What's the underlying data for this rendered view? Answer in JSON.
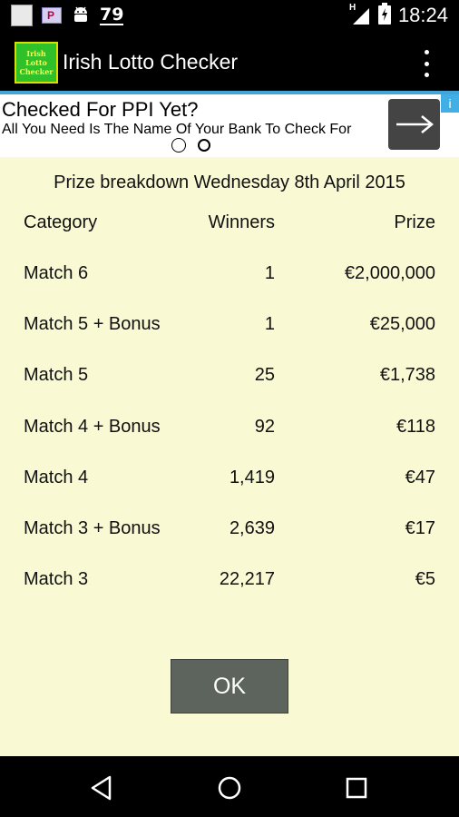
{
  "status_bar": {
    "notif_badge": "P",
    "battery_level": "79",
    "network_type": "H",
    "time": "18:24",
    "icons": [
      "notification-square-icon",
      "parking-badge-icon",
      "android-icon",
      "signal-icon",
      "battery-icon"
    ]
  },
  "action_bar": {
    "logo_lines": [
      "Irish",
      "Lotto",
      "Checker"
    ],
    "title": "Irish Lotto Checker",
    "menu_icon": "overflow-menu-icon"
  },
  "ad": {
    "title": "Checked For PPI Yet?",
    "subtitle": "All You Need Is The Name Of Your Bank To Check For",
    "info_label": "i",
    "accent": "#42a5d9"
  },
  "dialog": {
    "title": "Prize breakdown Wednesday 8th April 2015",
    "headers": {
      "category": "Category",
      "winners": "Winners",
      "prize": "Prize"
    },
    "rows": [
      {
        "category": "Match 6",
        "winners": "1",
        "prize": "€2,000,000"
      },
      {
        "category": "Match 5 + Bonus",
        "winners": "1",
        "prize": "€25,000"
      },
      {
        "category": "Match 5",
        "winners": "25",
        "prize": "€1,738"
      },
      {
        "category": "Match 4 + Bonus",
        "winners": "92",
        "prize": "€118"
      },
      {
        "category": "Match 4",
        "winners": "1,419",
        "prize": "€47"
      },
      {
        "category": "Match 3 + Bonus",
        "winners": "2,639",
        "prize": "€17"
      },
      {
        "category": "Match 3",
        "winners": "22,217",
        "prize": "€5"
      }
    ],
    "ok_label": "OK",
    "background": "#f9f9d4"
  },
  "nav_bar": {
    "buttons": [
      "back-icon",
      "home-icon",
      "recents-icon"
    ]
  }
}
